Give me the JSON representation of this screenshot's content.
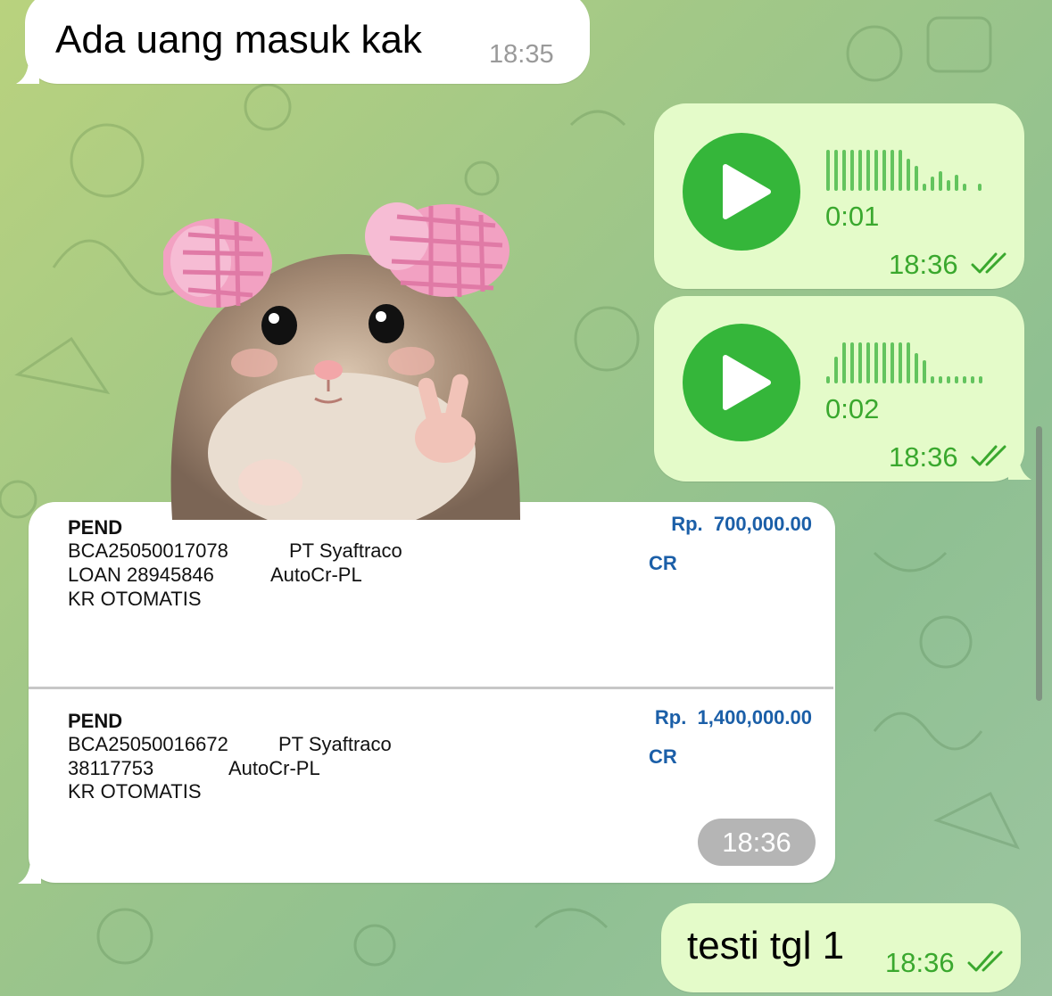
{
  "messages": {
    "incoming_text": {
      "text": "Ada uang masuk kak",
      "time": "18:35"
    },
    "voice_1": {
      "duration": "0:01",
      "time": "18:36"
    },
    "voice_2": {
      "duration": "0:02",
      "time": "18:36"
    },
    "transfer_screenshot": {
      "time": "18:36",
      "transactions": [
        {
          "type": "PEND",
          "line1_ref": "BCA25050017078",
          "line1_name": "PT Syaftraco",
          "line2_ref": "LOAN 28945846",
          "line2_desc": "AutoCr-PL",
          "line3": "KR OTOMATIS",
          "amount": "Rp.  700,000.00",
          "dc": "CR"
        },
        {
          "type": "PEND",
          "line1_ref": "BCA25050016672",
          "line1_name": "PT Syaftraco",
          "line2_ref": "38117753",
          "line2_desc": "AutoCr-PL",
          "line3": "KR OTOMATIS",
          "amount": "Rp.  1,400,000.00",
          "dc": "CR"
        }
      ]
    },
    "outgoing_text": {
      "text": "testi tgl 1",
      "time": "18:36"
    }
  },
  "icons": {
    "play": "play-icon",
    "read_receipt": "double-check-icon",
    "sticker": "hamster-peace-sticker"
  },
  "colors": {
    "outgoing_bubble": "#e4fbc9",
    "incoming_bubble": "#ffffff",
    "accent_green": "#35b63a",
    "time_green": "#3aa82e",
    "amount_blue": "#1b5fa8"
  }
}
